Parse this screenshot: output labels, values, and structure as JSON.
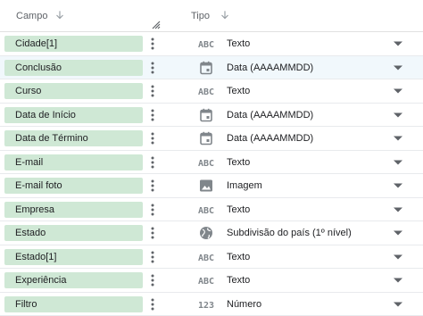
{
  "header": {
    "campo_label": "Campo",
    "tipo_label": "Tipo"
  },
  "rows": [
    {
      "field": "Cidade[1]",
      "type_label": "Texto",
      "type_icon": "abc-text-icon",
      "selected": false
    },
    {
      "field": "Conclusão",
      "type_label": "Data (AAAAMMDD)",
      "type_icon": "calendar-icon",
      "selected": true
    },
    {
      "field": "Curso",
      "type_label": "Texto",
      "type_icon": "abc-text-icon",
      "selected": false
    },
    {
      "field": "Data de Início",
      "type_label": "Data (AAAAMMDD)",
      "type_icon": "calendar-icon",
      "selected": false
    },
    {
      "field": "Data de Término",
      "type_label": "Data (AAAAMMDD)",
      "type_icon": "calendar-icon",
      "selected": false
    },
    {
      "field": "E-mail",
      "type_label": "Texto",
      "type_icon": "abc-text-icon",
      "selected": false
    },
    {
      "field": "E-mail foto",
      "type_label": "Imagem",
      "type_icon": "image-icon",
      "selected": false
    },
    {
      "field": "Empresa",
      "type_label": "Texto",
      "type_icon": "abc-text-icon",
      "selected": false
    },
    {
      "field": "Estado",
      "type_label": "Subdivisão do país (1º nível)",
      "type_icon": "globe-icon",
      "selected": false
    },
    {
      "field": "Estado[1]",
      "type_label": "Texto",
      "type_icon": "abc-text-icon",
      "selected": false
    },
    {
      "field": "Experiência",
      "type_label": "Texto",
      "type_icon": "abc-text-icon",
      "selected": false
    },
    {
      "field": "Filtro",
      "type_label": "Número",
      "type_icon": "number-123-icon",
      "selected": false
    }
  ],
  "icon_text": {
    "abc": "ABC",
    "num": "123"
  },
  "colors": {
    "chip_background": "#cfe8d5",
    "icon_gray": "#80868b",
    "selected_row": "#f1f8fc"
  }
}
